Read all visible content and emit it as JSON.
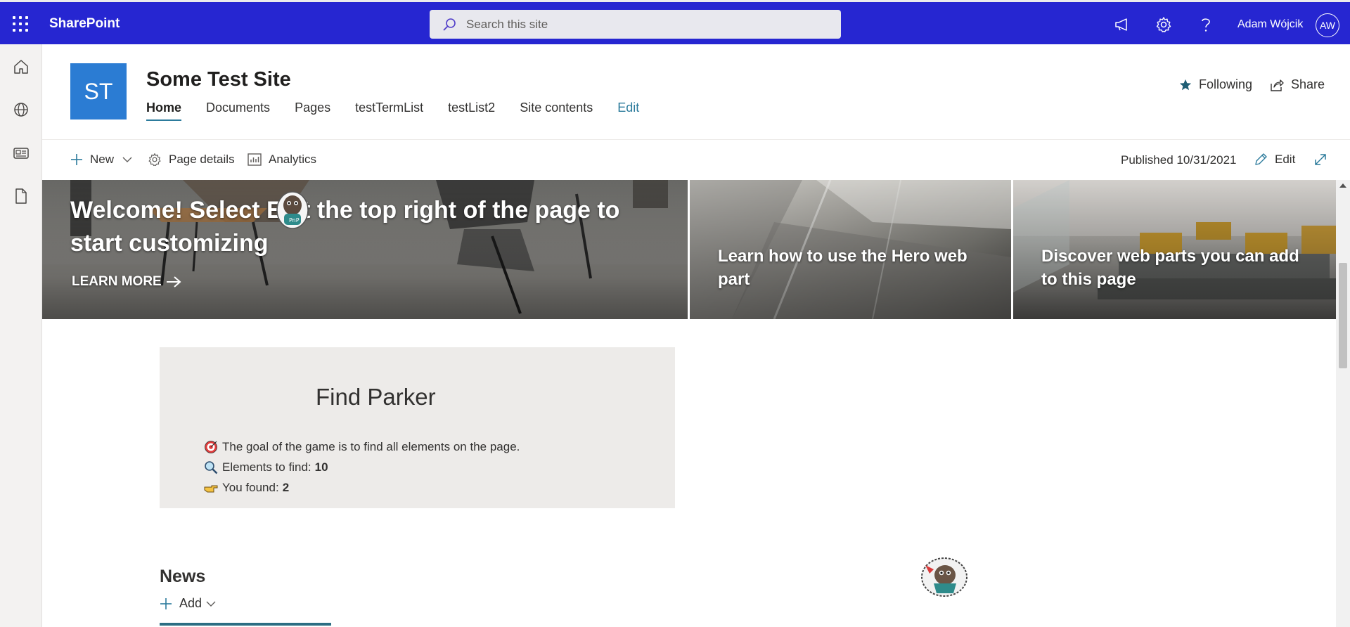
{
  "suitebar": {
    "brand": "SharePoint",
    "search_placeholder": "Search this site",
    "user_name": "Adam Wójcik",
    "user_initials": "AW",
    "icons": [
      "app-launcher-icon",
      "megaphone-icon",
      "gear-icon",
      "help-icon"
    ],
    "color": "#2626d1"
  },
  "appbar": {
    "icons": [
      "home-icon",
      "globe-icon",
      "news-icon",
      "file-icon"
    ]
  },
  "site": {
    "logo_text": "ST",
    "logo_color": "#2b7cd3",
    "title": "Some Test Site",
    "nav": [
      {
        "label": "Home",
        "active": true
      },
      {
        "label": "Documents"
      },
      {
        "label": "Pages"
      },
      {
        "label": "testTermList"
      },
      {
        "label": "testList2"
      },
      {
        "label": "Site contents"
      },
      {
        "label": "Edit"
      }
    ],
    "following_label": "Following",
    "share_label": "Share",
    "accent": "#2c7b9c"
  },
  "commandbar": {
    "new_label": "New",
    "page_details_label": "Page details",
    "analytics_label": "Analytics",
    "published": "Published 10/31/2021",
    "edit_label": "Edit"
  },
  "hero": {
    "tile1_title": "Welcome! Select E at the top right of the page to start customizing",
    "tile1_link": "LEARN MORE",
    "tile2_title": "Learn how to use the Hero web part",
    "tile3_title": "Discover web parts you can add to this page"
  },
  "game": {
    "title": "Find Parker",
    "goal_text": "The goal of the game is to find all elements on the page.",
    "elements_label": "Elements to find:",
    "elements_value": "10",
    "found_label": "You found:",
    "found_value": "2"
  },
  "news": {
    "title": "News",
    "add_label": "Add",
    "accent": "#2c6e83"
  }
}
